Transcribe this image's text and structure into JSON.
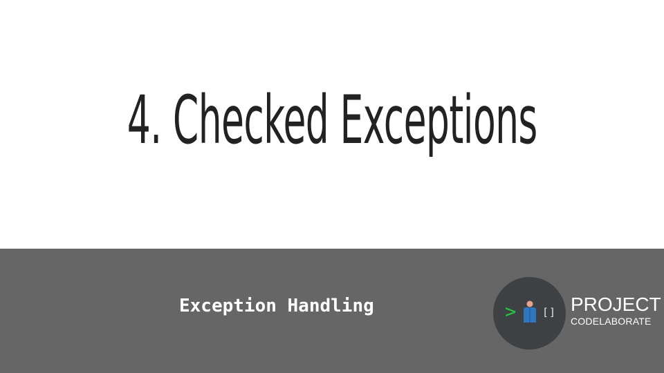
{
  "slide": {
    "title": "4. Checked Exceptions",
    "subtitle": "Exception Handling"
  },
  "logo": {
    "prompt_symbol": ">",
    "brackets": "[]",
    "word1": "PROJECT",
    "word2": "CODELABORATE",
    "icon": "person-icon"
  },
  "colors": {
    "title_background": "#ffffff",
    "footer_background": "#666666",
    "title_text": "#222222",
    "subtitle_text": "#ffffff",
    "badge_background": "#3d4144",
    "prompt_green": "#27c840",
    "person_blue": "#2f78bf",
    "person_skin": "#e8a48e"
  }
}
